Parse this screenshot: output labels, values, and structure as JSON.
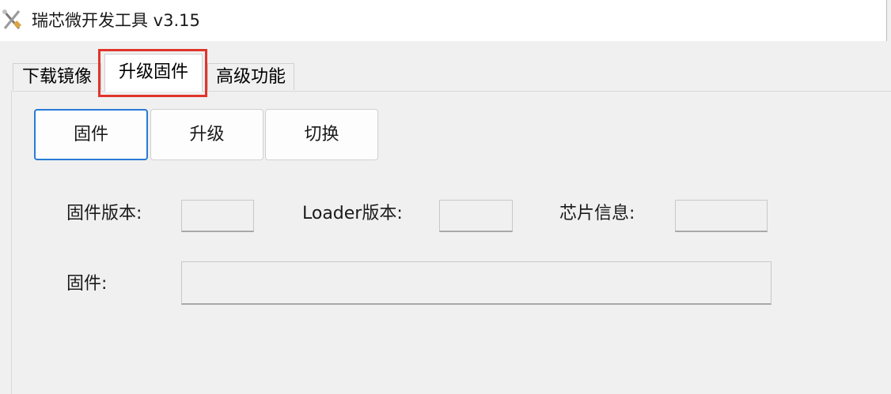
{
  "window": {
    "title": "瑞芯微开发工具 v3.15",
    "app_icon": "tools-icon"
  },
  "tabs": [
    {
      "label": "下载镜像",
      "selected": false
    },
    {
      "label": "升级固件",
      "selected": true,
      "highlighted": true
    },
    {
      "label": "高级功能",
      "selected": false
    }
  ],
  "colors": {
    "highlight_border": "#e0352b",
    "focused_button_border": "#2a7ad6"
  },
  "buttons": {
    "firmware": "固件",
    "upgrade": "升级",
    "switch": "切换"
  },
  "info": {
    "firmware_version_label": "固件版本:",
    "firmware_version_value": "",
    "loader_version_label": "Loader版本:",
    "loader_version_value": "",
    "chip_info_label": "芯片信息:",
    "chip_info_value": "",
    "firmware_label": "固件:",
    "firmware_value": ""
  }
}
